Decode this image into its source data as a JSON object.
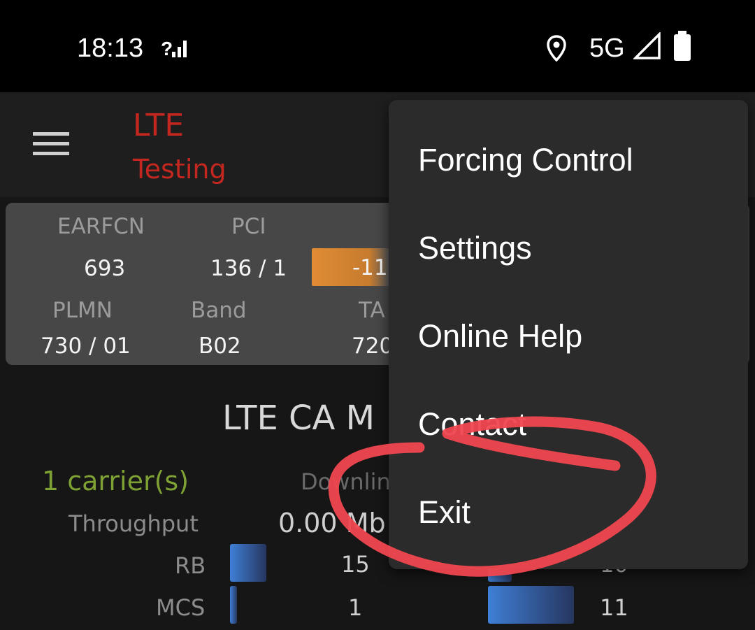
{
  "status_bar": {
    "time": "18:13",
    "signal_unknown_icon": "signal-unknown-icon",
    "location_icon": "location-icon",
    "network_type": "5G",
    "cell_signal_icon": "cell-signal-icon",
    "battery_icon": "battery-icon"
  },
  "app_bar": {
    "menu_icon": "hamburger-menu-icon",
    "title_line1": "LTE",
    "title_line2": "Testing",
    "title_color": "#c4271f"
  },
  "info_card": {
    "labels": {
      "earfcn": "EARFCN",
      "pci": "PCI",
      "plmn": "PLMN",
      "band": "Band",
      "ta": "TA"
    },
    "values": {
      "earfcn": "693",
      "pci": "136 / 1",
      "rsrp": "-11",
      "plmn": "730 / 01",
      "band": "B02",
      "ta": "720"
    },
    "rsrp_color": "#e08c34"
  },
  "ca_section": {
    "title": "LTE CA M",
    "carriers": "1 carrier(s)",
    "carriers_color": "#7ea133",
    "downlink_label": "Downlin",
    "throughput_label": "Throughput",
    "throughput_value": "0.00 Mb",
    "rows": [
      {
        "label": "RB",
        "dl_value": "15",
        "ul_value": "10"
      },
      {
        "label": "MCS",
        "dl_value": "1",
        "ul_value": "11"
      }
    ]
  },
  "overflow_menu": {
    "items": [
      {
        "label": "Forcing Control"
      },
      {
        "label": "Settings"
      },
      {
        "label": "Online Help"
      },
      {
        "label": "Contact"
      },
      {
        "label": "Exit"
      }
    ]
  },
  "annotation": {
    "color": "#f0474f",
    "shape": "hand-drawn circle around Exit"
  }
}
